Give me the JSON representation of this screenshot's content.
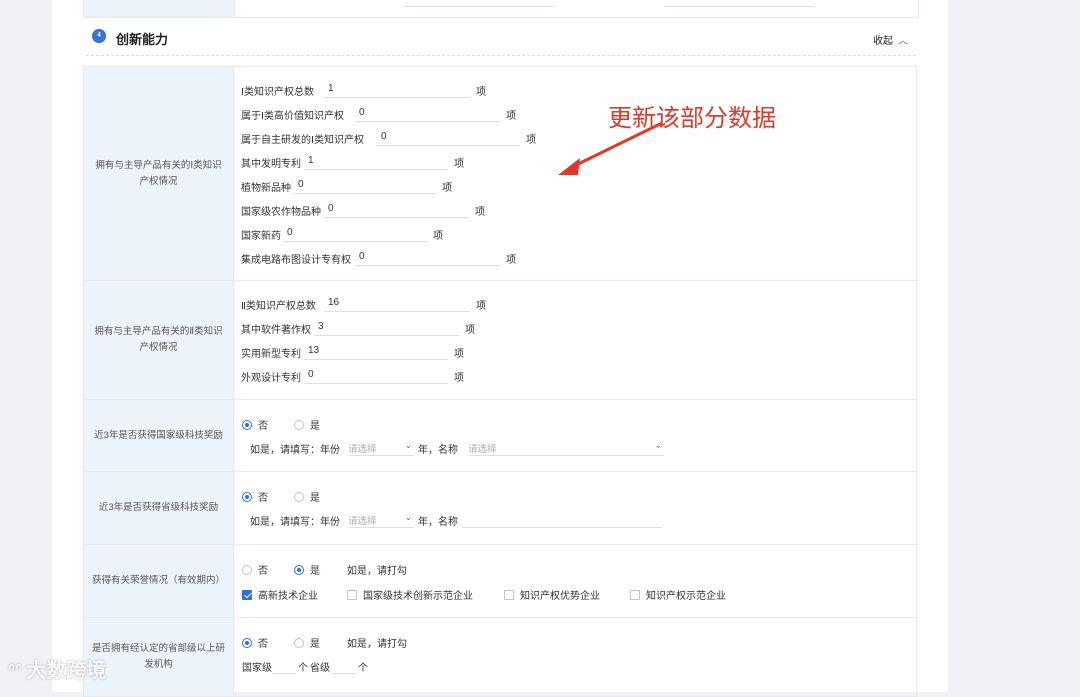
{
  "section": {
    "number": "4",
    "title": "创新能力",
    "collapse_label": "收起"
  },
  "annotation": "更新该部分数据",
  "watermark": "大数跨境",
  "ip_class1": {
    "label": "拥有与主导产品有关的Ⅰ类知识产权情况",
    "fields": [
      {
        "label": "Ⅰ类知识产权总数",
        "value": "1",
        "unit": "项"
      },
      {
        "label": "属于Ⅰ类高价值知识产权",
        "value": "0",
        "unit": "项"
      },
      {
        "label": "属于自主研发的Ⅰ类知识产权",
        "value": "0",
        "unit": "项"
      },
      {
        "label": "其中发明专利",
        "value": "1",
        "unit": "项"
      },
      {
        "label": "植物新品种",
        "value": "0",
        "unit": "项"
      },
      {
        "label": "国家级农作物品种",
        "value": "0",
        "unit": "项"
      },
      {
        "label": "国家新药",
        "value": "0",
        "unit": "项"
      },
      {
        "label": "集成电路布图设计专有权",
        "value": "0",
        "unit": "项"
      }
    ]
  },
  "ip_class2": {
    "label": "拥有与主导产品有关的Ⅱ类知识产权情况",
    "fields": [
      {
        "label": "Ⅱ类知识产权总数",
        "value": "16",
        "unit": "项"
      },
      {
        "label": "其中软件著作权",
        "value": "3",
        "unit": "项"
      },
      {
        "label": "实用新型专利",
        "value": "13",
        "unit": "项"
      },
      {
        "label": "外观设计专利",
        "value": "0",
        "unit": "项"
      }
    ]
  },
  "national_award": {
    "label": "近3年是否获得国家级科技奖励",
    "opt_no": "否",
    "opt_yes": "是",
    "selected": "否",
    "if_text": "如是，请填写：年份",
    "year_placeholder": "请选择",
    "year_suffix": "年，名称",
    "name_placeholder": "请选择"
  },
  "provincial_award": {
    "label": "近3年是否获得省级科技奖励",
    "opt_no": "否",
    "opt_yes": "是",
    "selected": "否",
    "if_text": "如是，请填写：年份",
    "year_placeholder": "请选择",
    "year_suffix": "年，名称"
  },
  "honors": {
    "label": "获得有关荣誉情况（有效期内）",
    "opt_no": "否",
    "opt_yes": "是",
    "selected": "是",
    "hint": "如是，请打勾",
    "checks": [
      {
        "label": "高新技术企业",
        "checked": true
      },
      {
        "label": "国家级技术创新示范企业",
        "checked": false
      },
      {
        "label": "知识产权优势企业",
        "checked": false
      },
      {
        "label": "知识产权示范企业",
        "checked": false
      }
    ]
  },
  "rd_institution": {
    "label": "是否拥有经认定的省部级以上研发机构",
    "opt_no": "否",
    "opt_yes": "是",
    "selected": "否",
    "hint": "如是，请打勾",
    "national_label": "国家级",
    "unit1": "个",
    "provincial_label": "省级",
    "unit2": "个"
  }
}
